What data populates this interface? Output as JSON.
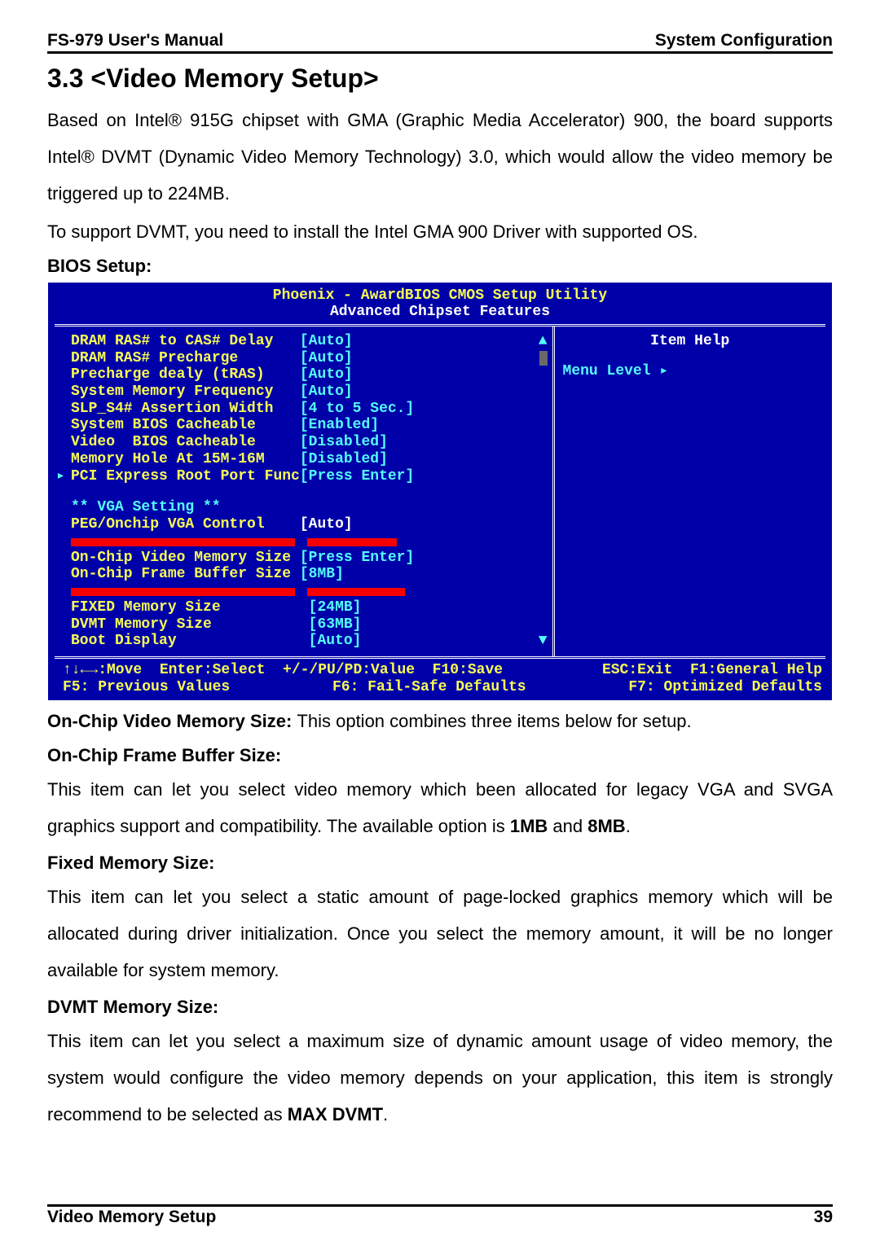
{
  "header": {
    "left": "FS-979 User's Manual",
    "right": "System Configuration"
  },
  "section_title": "3.3 <Video Memory Setup>",
  "intro_para": "Based on Intel® 915G chipset with GMA (Graphic Media Accelerator) 900, the board supports Intel® DVMT (Dynamic Video Memory Technology) 3.0, which would allow the video memory be triggered up to 224MB.",
  "intro_line2": "To support DVMT, you need to install the Intel GMA 900 Driver with supported OS.",
  "bios_label": "BIOS Setup:",
  "bios": {
    "title1": "Phoenix - AwardBIOS CMOS Setup Utility",
    "title2": "Advanced Chipset Features",
    "rows": {
      "r1l": "DRAM RAS# to CAS# Delay",
      "r1v": "[Auto]",
      "r2l": "DRAM RAS# Precharge",
      "r2v": "[Auto]",
      "r3l": "Precharge dealy (tRAS)",
      "r3v": "[Auto]",
      "r4l": "System Memory Frequency",
      "r4v": "[Auto]",
      "r5l": "SLP_S4# Assertion Width",
      "r5v": "[4 to 5 Sec.]",
      "r6l": "System BIOS Cacheable",
      "r6v": "[Enabled]",
      "r7l": "Video  BIOS Cacheable",
      "r7v": "[Disabled]",
      "r8l": "Memory Hole At 15M-16M",
      "r8v": "[Disabled]",
      "r9l": "PCI Express Root Port Func",
      "r9v": "[Press Enter]",
      "vga": "** VGA Setting **",
      "r10l": "PEG/Onchip VGA Control",
      "r10v": "[Auto]",
      "r12l": "On-Chip Video Memory Size",
      "r12v": "[Press Enter]",
      "r13l": "On-Chip Frame Buffer Size",
      "r13v": "[8MB]",
      "r15l": "FIXED Memory Size",
      "r15v": "[24MB]",
      "r16l": "DVMT Memory Size",
      "r16v": "[63MB]",
      "r17l": "Boot Display",
      "r17v": "[Auto]"
    },
    "help_title": "Item Help",
    "help_row": "Menu Level   ▸",
    "footer": {
      "a": "↑↓←→:Move  Enter:Select  +/-/PU/PD:Value  F10:Save",
      "b": "ESC:Exit  F1:General Help",
      "c": "F5: Previous Values",
      "d": "F6: Fail-Safe Defaults",
      "e": "F7: Optimized Defaults"
    }
  },
  "desc": {
    "ocvms_label": "On-Chip Video Memory Size: ",
    "ocvms_text": "This option combines three items below for setup.",
    "ocfb_label": "On-Chip Frame Buffer Size:",
    "ocfb_text_a": "This item can let you select video memory which been allocated for legacy VGA and SVGA graphics support and compatibility. The available option is ",
    "ocfb_1mb": "1MB",
    "ocfb_and": " and ",
    "ocfb_8mb": "8MB",
    "ocfb_dot": ".",
    "fms_label": "Fixed Memory Size:",
    "fms_text": "This item can let you select a static amount of page-locked graphics memory which will be allocated during driver initialization. Once you select the memory amount, it will be no longer available for system memory.",
    "dvmt_label": "DVMT Memory Size:",
    "dvmt_text_a": "This item can let you select a maximum size of dynamic amount usage of video memory, the system would configure the video memory depends on your application, this item is strongly recommend to be selected as ",
    "dvmt_bold": "MAX DVMT",
    "dvmt_dot": "."
  },
  "footer": {
    "left": "Video Memory Setup",
    "right": "39"
  }
}
